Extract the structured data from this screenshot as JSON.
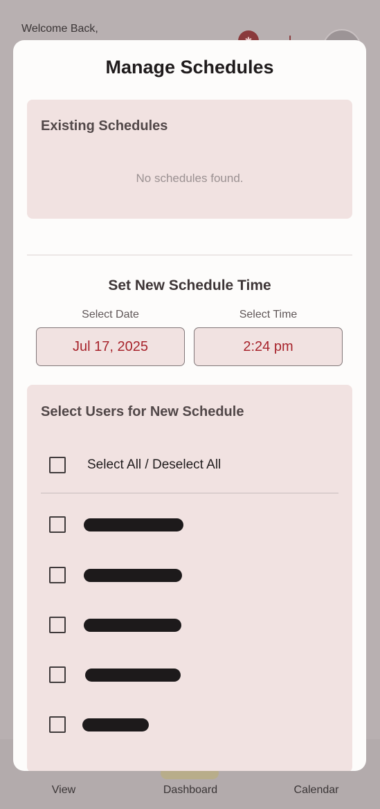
{
  "background": {
    "welcome_text": "Welcome Back,",
    "bottom_nav": [
      {
        "label": "View",
        "icon": "view-icon"
      },
      {
        "label": "Dashboard",
        "icon": "dashboard-icon"
      },
      {
        "label": "Calendar",
        "icon": "calendar-icon"
      }
    ]
  },
  "modal": {
    "title": "Manage Schedules",
    "existing": {
      "title": "Existing Schedules",
      "empty_text": "No schedules found."
    },
    "new_schedule": {
      "title": "Set New Schedule Time",
      "date_label": "Select Date",
      "date_value": "Jul 17, 2025",
      "time_label": "Select Time",
      "time_value": "2:24 pm"
    },
    "users": {
      "title": "Select Users for New Schedule",
      "select_all_label": "Select All / Deselect All",
      "select_all_checked": false,
      "user_rows": 5
    }
  },
  "colors": {
    "accent": "#a7232b",
    "card_bg": "#f1e2e1",
    "modal_bg": "#fdfcfb"
  }
}
